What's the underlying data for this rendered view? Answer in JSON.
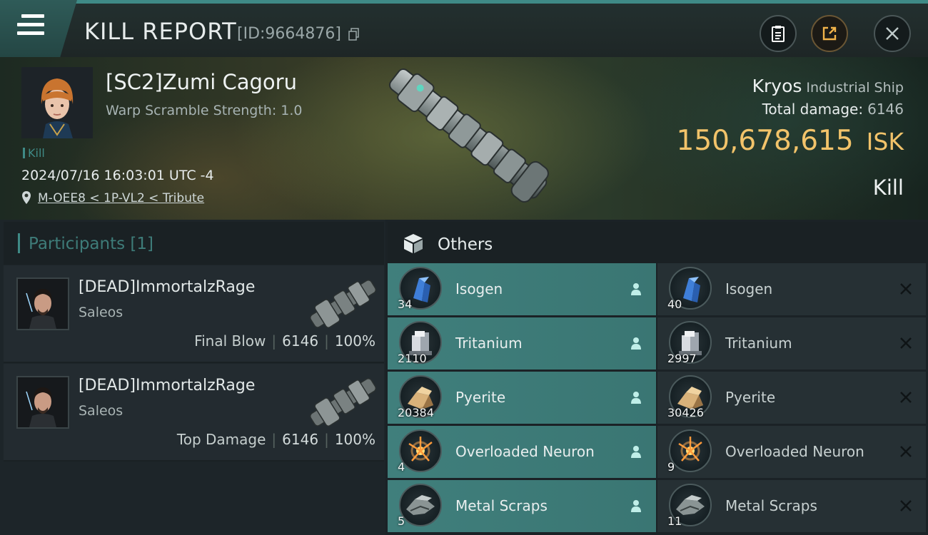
{
  "header": {
    "title": "KILL REPORT",
    "report_id": "[ID:9664876]"
  },
  "victim": {
    "name": "[SC2]Zumi Cagoru",
    "warp_scramble": "Warp Scramble Strength: 1.0",
    "tag": "Kill",
    "timestamp": "2024/07/16 16:03:01 UTC -4",
    "location": "M-OEE8 < 1P-VL2 < Tribute",
    "ship_name": "Kryos",
    "ship_class": "Industrial Ship",
    "total_damage_label": "Total damage:",
    "total_damage": "6146",
    "isk_value": "150,678,615",
    "isk_unit": "ISK",
    "result": "Kill"
  },
  "participants": {
    "title": "Participants [1]",
    "rows": [
      {
        "name": "[DEAD]ImmortalzRage",
        "ship": "Saleos",
        "role": "Final Blow",
        "damage": "6146",
        "percent": "100%"
      },
      {
        "name": "[DEAD]ImmortalzRage",
        "ship": "Saleos",
        "role": "Top Damage",
        "damage": "6146",
        "percent": "100%"
      }
    ]
  },
  "others": {
    "title": "Others",
    "dropped": [
      {
        "name": "Isogen",
        "qty": "34",
        "icon": "isogen-icon"
      },
      {
        "name": "Tritanium",
        "qty": "2110",
        "icon": "tritanium-icon"
      },
      {
        "name": "Pyerite",
        "qty": "20384",
        "icon": "pyerite-icon"
      },
      {
        "name": "Overloaded Neuron",
        "qty": "4",
        "icon": "overloaded-neuron-icon"
      },
      {
        "name": "Metal Scraps",
        "qty": "5",
        "icon": "metal-scraps-icon"
      }
    ],
    "destroyed": [
      {
        "name": "Isogen",
        "qty": "40",
        "icon": "isogen-icon"
      },
      {
        "name": "Tritanium",
        "qty": "2997",
        "icon": "tritanium-icon"
      },
      {
        "name": "Pyerite",
        "qty": "30426",
        "icon": "pyerite-icon"
      },
      {
        "name": "Overloaded Neuron",
        "qty": "9",
        "icon": "overloaded-neuron-icon"
      },
      {
        "name": "Metal Scraps",
        "qty": "11",
        "icon": "metal-scraps-icon"
      }
    ]
  },
  "colors": {
    "accent_teal": "#3f8a86",
    "isk_gold": "#f2c36a",
    "dropped_bg": "#407f7c",
    "destroyed_bg": "#263034"
  }
}
